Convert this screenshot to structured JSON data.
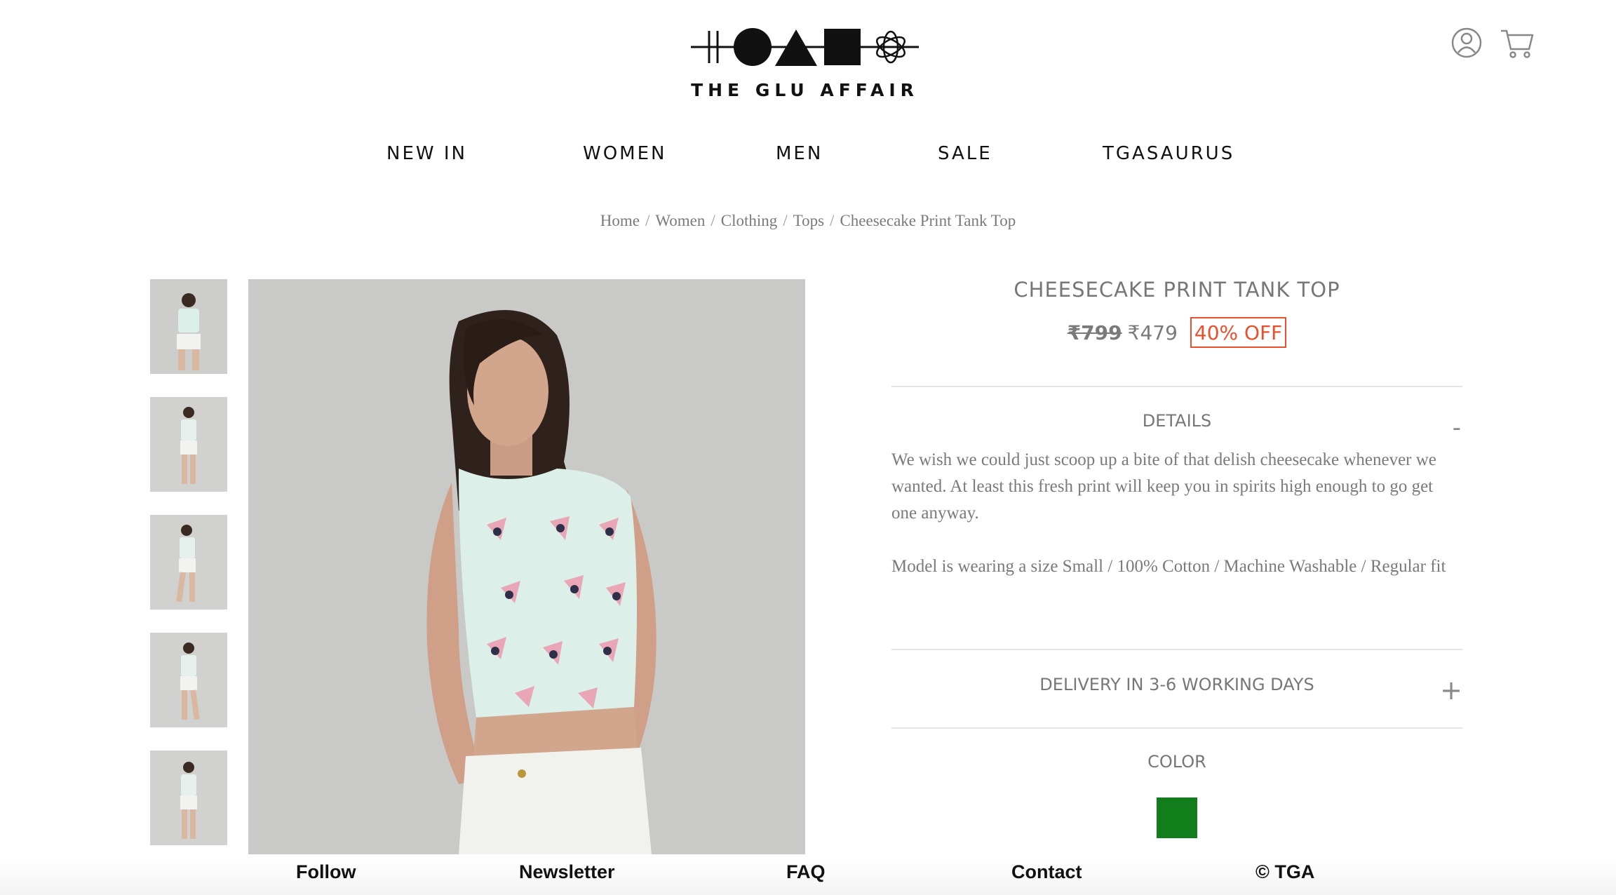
{
  "header": {
    "brand": "THE GLU AFFAIR",
    "logo_icon": "tga-logo-icon",
    "user_icon": "user-account-icon",
    "cart_icon": "shopping-cart-icon"
  },
  "nav": {
    "items": [
      {
        "label": "NEW IN"
      },
      {
        "label": "WOMEN"
      },
      {
        "label": "MEN"
      },
      {
        "label": "SALE"
      },
      {
        "label": "TGASAURUS"
      }
    ]
  },
  "breadcrumb": {
    "items": [
      "Home",
      "Women",
      "Clothing",
      "Tops",
      "Cheesecake Print Tank Top"
    ],
    "separator": "/"
  },
  "gallery": {
    "thumbnail_count": 5,
    "image_background": "#c8c9c6"
  },
  "product": {
    "title": "CHEESECAKE PRINT TANK TOP",
    "price_old": "₹799",
    "price_new": "₹479",
    "discount": "40% OFF",
    "discount_color": "#e8502e",
    "details_label": "DETAILS",
    "details_toggle": "-",
    "description": "We wish we could just scoop up a bite of that delish cheesecake whenever we wanted. At least this fresh print will keep you in spirits high enough to go get one anyway.",
    "specs": "Model is wearing a size Small / 100% Cotton / Machine Washable / Regular fit",
    "delivery_label": "DELIVERY IN 3-6 WORKING DAYS",
    "delivery_toggle": "+",
    "color_label": "COLOR",
    "color_swatch": "#117d1b"
  },
  "footer": {
    "follow": "Follow",
    "newsletter": "Newsletter",
    "faq": "FAQ",
    "contact": "Contact",
    "copyright": "© TGA"
  }
}
